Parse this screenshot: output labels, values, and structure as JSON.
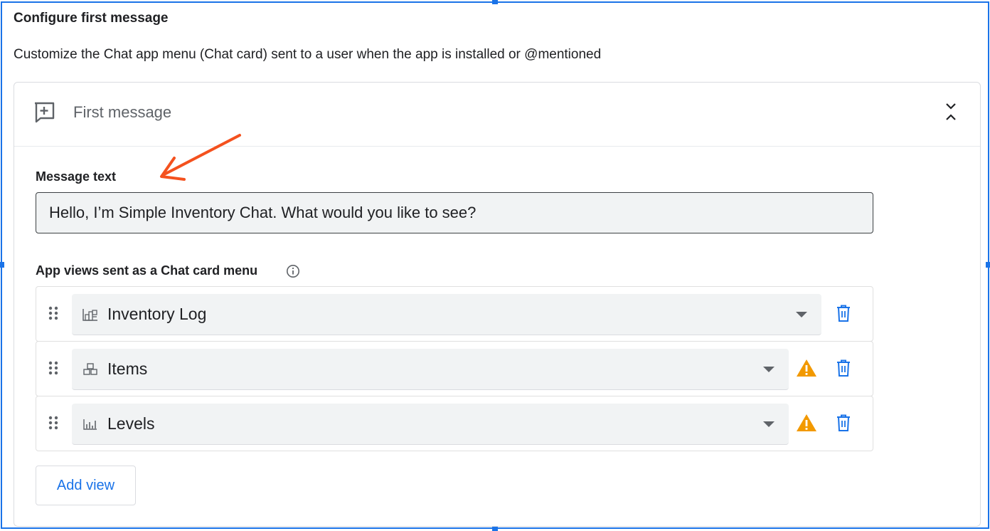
{
  "section": {
    "title": "Configure first message",
    "description": "Customize the Chat app menu (Chat card) sent to a user when the app is installed or @mentioned"
  },
  "card": {
    "icon": "add-comment-icon",
    "title": "First message",
    "collapse_icon": "collapse-icon"
  },
  "message": {
    "label": "Message text",
    "value": "Hello, I’m Simple Inventory Chat. What would you like to see?"
  },
  "views": {
    "label": "App views sent as a Chat card menu",
    "info_icon": "info-icon",
    "items": [
      {
        "name": "Inventory Log",
        "icon": "table-view-icon",
        "warning": false
      },
      {
        "name": "Items",
        "icon": "boxes-icon",
        "warning": true
      },
      {
        "name": "Levels",
        "icon": "bar-chart-icon",
        "warning": true
      }
    ]
  },
  "add_view_label": "Add view",
  "colors": {
    "accent": "#1a73e8",
    "warning": "#f29900",
    "annotation_arrow": "#f4511e",
    "field_bg": "#f1f3f4"
  }
}
